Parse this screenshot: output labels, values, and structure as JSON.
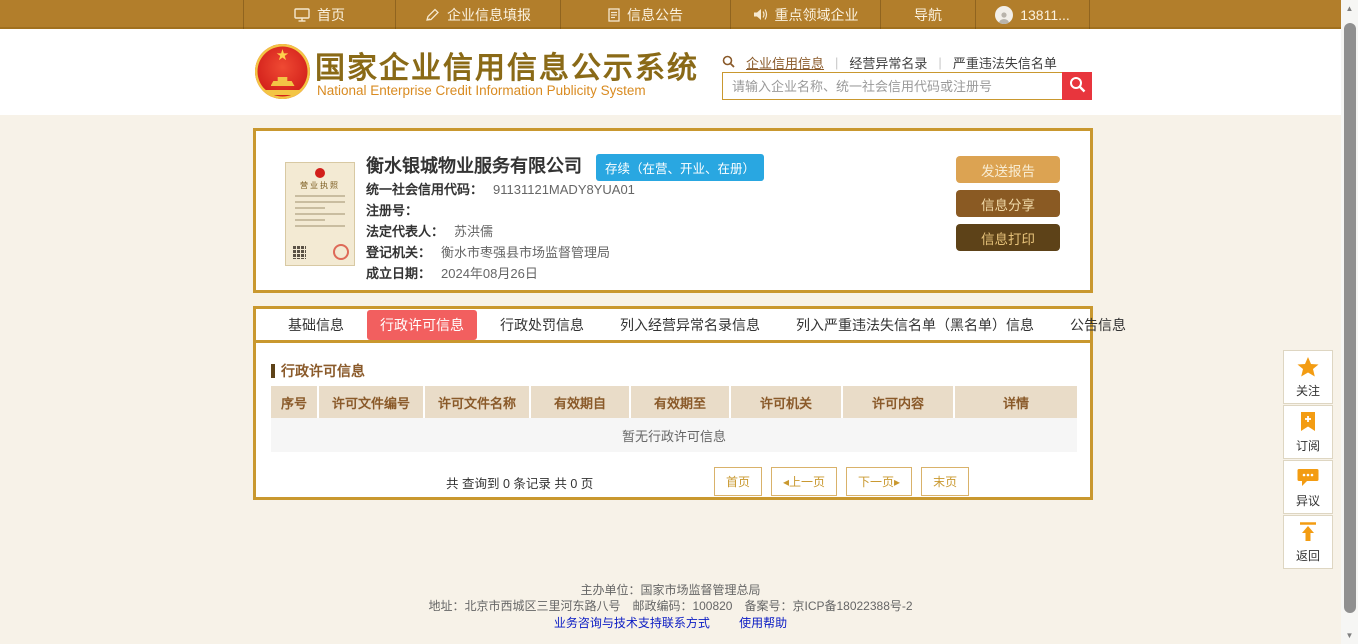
{
  "topnav": {
    "items": [
      {
        "label": "首页",
        "icon": "monitor-icon"
      },
      {
        "label": "企业信息填报",
        "icon": "pen-icon"
      },
      {
        "label": "信息公告",
        "icon": "document-icon"
      },
      {
        "label": "重点领域企业",
        "icon": "speaker-icon"
      },
      {
        "label": "导航",
        "icon": ""
      },
      {
        "label": "13811...",
        "icon": "avatar"
      }
    ]
  },
  "header": {
    "title": "国家企业信用信息公示系统",
    "subtitle": "National Enterprise Credit Information Publicity System",
    "logo_icon": "national-emblem",
    "emblem_star": "★",
    "search_links": [
      {
        "label": "企业信用信息",
        "active": true
      },
      {
        "label": "经营异常名录",
        "active": false
      },
      {
        "label": "严重违法失信名单",
        "active": false
      }
    ],
    "search_placeholder": "请输入企业名称、统一社会信用代码或注册号",
    "search_button_icon": "search-icon"
  },
  "company": {
    "name": "衡水银城物业服务有限公司",
    "status_badge": "存续（在营、开业、在册）",
    "license_title": "营业执照",
    "fields": [
      {
        "label": "统一社会信用代码：",
        "value": "91131121MADY8YUA01"
      },
      {
        "label": "注册号：",
        "value": ""
      },
      {
        "label": "法定代表人：",
        "value": "苏洪儒"
      },
      {
        "label": "登记机关：",
        "value": "衡水市枣强县市场监督管理局"
      },
      {
        "label": "成立日期：",
        "value": "2024年08月26日"
      }
    ],
    "actions": [
      {
        "label": "发送报告"
      },
      {
        "label": "信息分享"
      },
      {
        "label": "信息打印"
      }
    ]
  },
  "tabs": [
    "基础信息",
    "行政许可信息",
    "行政处罚信息",
    "列入经营异常名录信息",
    "列入严重违法失信名单（黑名单）信息",
    "公告信息"
  ],
  "active_tab": "行政许可信息",
  "section": {
    "title": "行政许可信息",
    "table_headers": [
      "序号",
      "许可文件编号",
      "许可文件名称",
      "有效期自",
      "有效期至",
      "许可机关",
      "许可内容",
      "详情"
    ],
    "empty_text": "暂无行政许可信息",
    "summary": "共 查询到 0 条记录 共 0 页",
    "pagination": [
      "首页",
      "◂上一页",
      "下一页▸",
      "末页"
    ]
  },
  "floating_sidebar": [
    {
      "label": "关注",
      "icon": "star-icon"
    },
    {
      "label": "订阅",
      "icon": "bookmark-plus-icon"
    },
    {
      "label": "异议",
      "icon": "comment-icon"
    },
    {
      "label": "返回",
      "icon": "back-to-top-icon"
    }
  ],
  "footer": {
    "line1": "主办单位：国家市场监督管理总局",
    "line2": "地址：北京市西城区三里河东路八号　邮政编码：100820　备案号：京ICP备18022388号-2",
    "links": [
      "业务咨询与技术支持联系方式",
      "使用帮助"
    ]
  },
  "colors": {
    "nav_gold": "#b27e2b",
    "border_gold": "#c9982f",
    "title_gold": "#8a6a17",
    "subtitle_orange": "#d98b21",
    "search_red": "#e8353d",
    "active_tab_red": "#f25f5f",
    "badge_blue": "#29a7e1",
    "table_header_beige": "#e9dcc8",
    "page_beige": "#f7f2e8",
    "sidebar_icon_orange": "#f39c12",
    "footer_link_blue": "#0a1bc4"
  }
}
